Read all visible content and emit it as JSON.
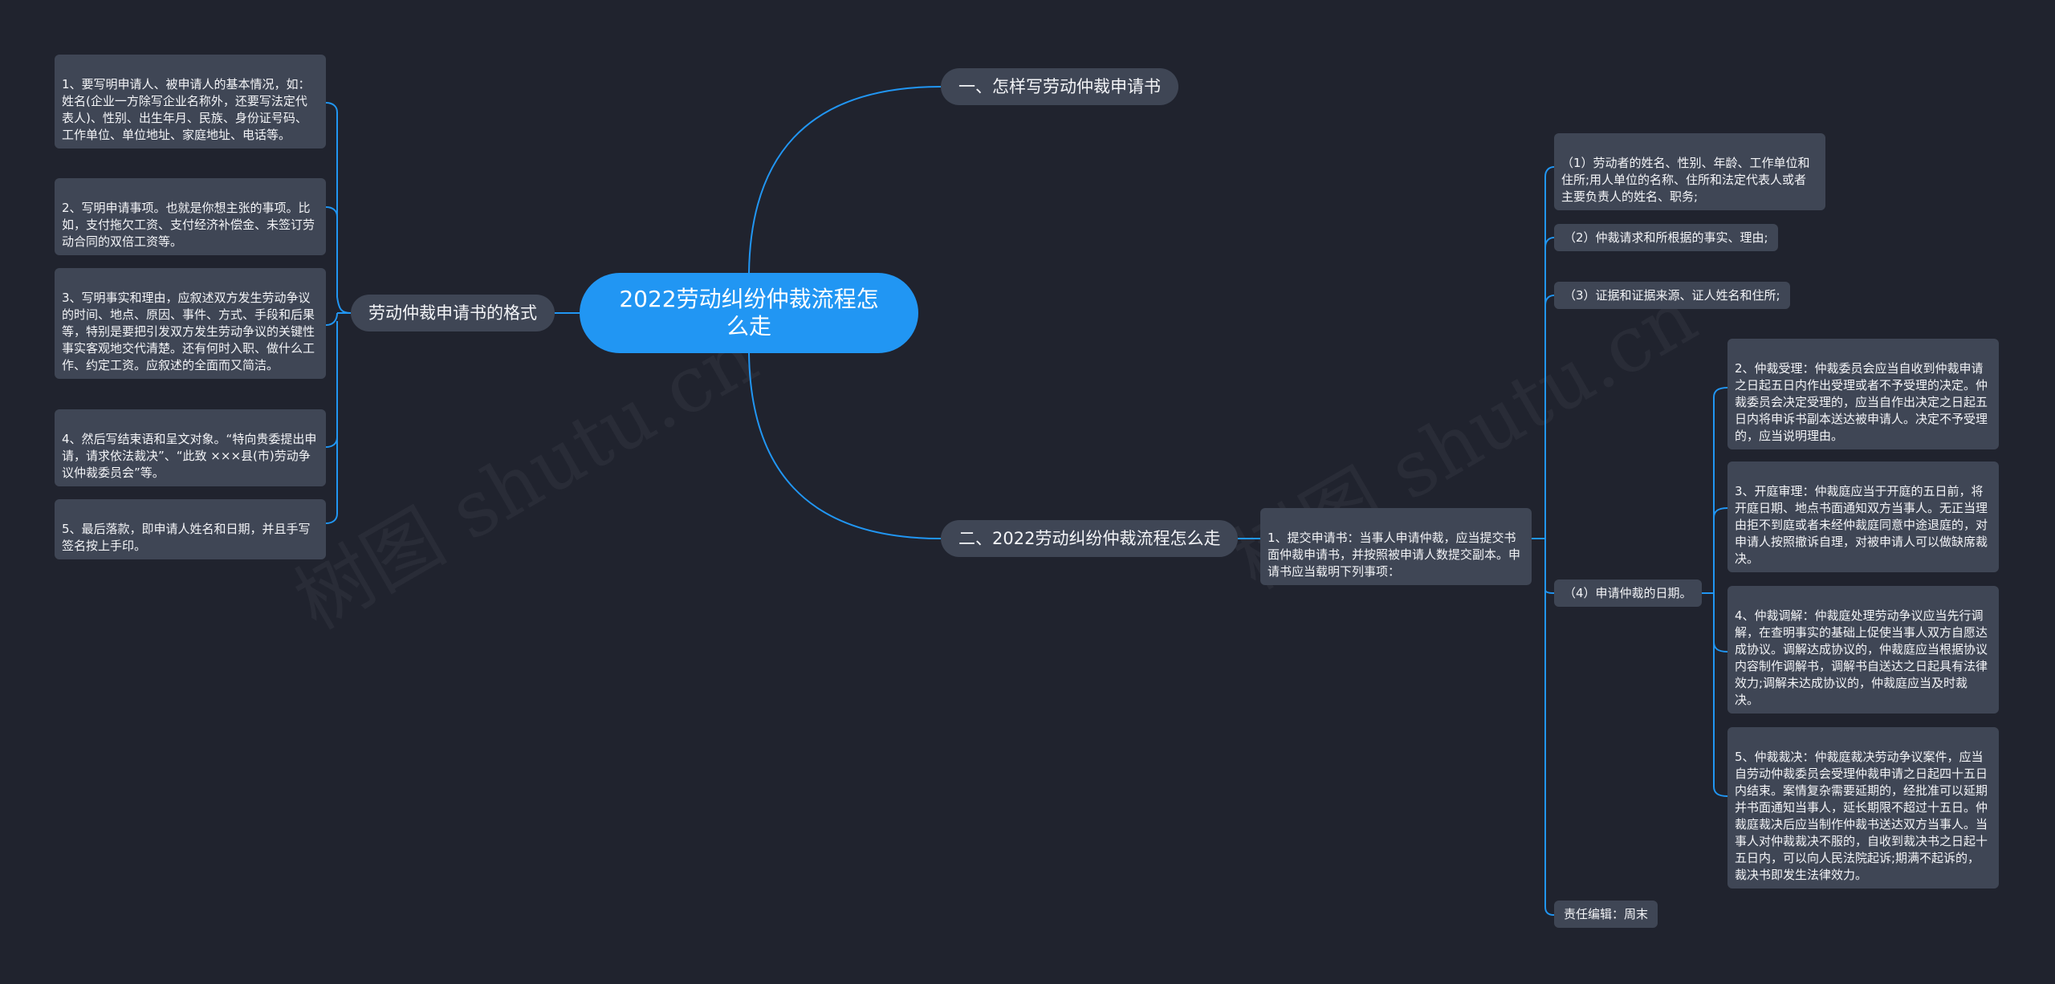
{
  "root": {
    "title": "2022劳动纠纷仲裁流程怎么走"
  },
  "branches": {
    "how_to_write": "一、怎样写劳动仲裁申请书",
    "process": "二、2022劳动纠纷仲裁流程怎么走",
    "format": "劳动仲裁申请书的格式"
  },
  "format_items": [
    "1、要写明申请人、被申请人的基本情况，如：姓名(企业一方除写企业名称外，还要写法定代表人)、性别、出生年月、民族、身份证号码、工作单位、单位地址、家庭地址、电话等。",
    "2、写明申请事项。也就是你想主张的事项。比如，支付拖欠工资、支付经济补偿金、未签订劳动合同的双倍工资等。",
    "3、写明事实和理由，应叙述双方发生劳动争议的时间、地点、原因、事件、方式、手段和后果等，特别是要把引发双方发生劳动争议的关键性事实客观地交代清楚。还有何时入职、做什么工作、约定工资。应叙述的全面而又简洁。",
    "4、然后写结束语和呈文对象。“特向贵委提出申请，请求依法裁决”、“此致 ×××县(市)劳动争议仲裁委员会”等。",
    "5、最后落款，即申请人姓名和日期，并且手写签名按上手印。"
  ],
  "process": {
    "step1": "1、提交申请书：当事人申请仲裁，应当提交书面仲裁申请书，并按照被申请人数提交副本。申请书应当载明下列事项：",
    "items": [
      "（1）劳动者的姓名、性别、年龄、工作单位和住所;用人单位的名称、住所和法定代表人或者主要负责人的姓名、职务;",
      "（2）仲裁请求和所根据的事实、理由;",
      "（3）证据和证据来源、证人姓名和住所;",
      "（4）申请仲裁的日期。",
      "责任编辑：周末"
    ],
    "steps": [
      "2、仲裁受理：仲裁委员会应当自收到仲裁申请之日起五日内作出受理或者不予受理的决定。仲裁委员会决定受理的，应当自作出决定之日起五日内将申诉书副本送达被申请人。决定不予受理的，应当说明理由。",
      "3、开庭审理：仲裁庭应当于开庭的五日前，将开庭日期、地点书面通知双方当事人。无正当理由拒不到庭或者未经仲裁庭同意中途退庭的，对申请人按照撤诉自理，对被申请人可以做缺席裁决。",
      "4、仲裁调解：仲裁庭处理劳动争议应当先行调解，在查明事实的基础上促使当事人双方自愿达成协议。调解达成协议的，仲裁庭应当根据协议内容制作调解书，调解书自送达之日起具有法律效力;调解未达成协议的，仲裁庭应当及时裁决。",
      "5、仲裁裁决：仲裁庭裁决劳动争议案件，应当自劳动仲裁委员会受理仲裁申请之日起四十五日内结束。案情复杂需要延期的，经批准可以延期并书面通知当事人，延长期限不超过十五日。仲裁庭裁决后应当制作仲裁书送达双方当事人。当事人对仲裁裁决不服的，自收到裁决书之日起十五日内，可以向人民法院起诉;期满不起诉的，裁决书即发生法律效力。"
    ]
  },
  "colors": {
    "background": "#20232e",
    "root": "#2196f3",
    "node": "#3f4655",
    "connector": "#2196f3"
  }
}
